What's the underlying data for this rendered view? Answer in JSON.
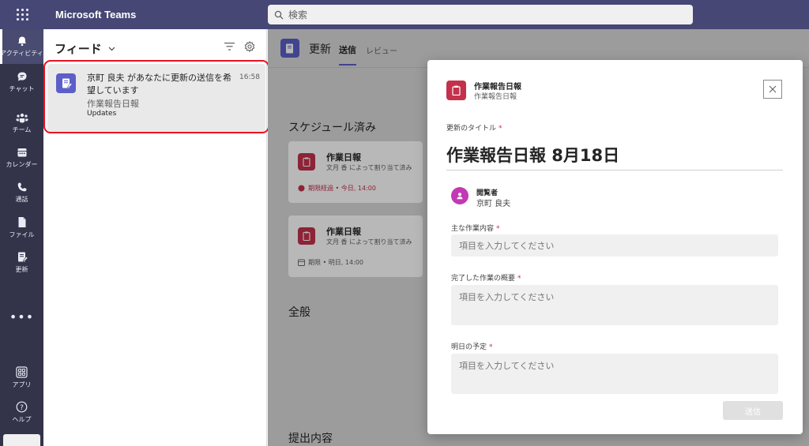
{
  "app": {
    "title": "Microsoft Teams"
  },
  "search": {
    "placeholder": "検索"
  },
  "rail": {
    "items": [
      {
        "label": "アクティビティ"
      },
      {
        "label": "チャット"
      },
      {
        "label": "チーム"
      },
      {
        "label": "カレンダー"
      },
      {
        "label": "通話"
      },
      {
        "label": "ファイル"
      },
      {
        "label": "更新"
      },
      {
        "label": "アプリ"
      },
      {
        "label": "ヘルプ"
      }
    ],
    "more": "•••"
  },
  "feed": {
    "title": "フィード",
    "item": {
      "message": "京町 良夫 があなたに更新の送信を希望しています",
      "subtitle": "作業報告日報",
      "app": "Updates",
      "time": "16:58"
    }
  },
  "main": {
    "title": "更新",
    "tabs": [
      {
        "label": "送信"
      },
      {
        "label": "レビュー"
      }
    ],
    "scheduled_title": "スケジュール済み",
    "cards": [
      {
        "title": "作業日報",
        "sub": "文月 香 によって割り当て済み",
        "due": "期限経過 • 今日, 14:00",
        "due_color": "#c4314b"
      },
      {
        "title": "作業日報",
        "sub": "文月 香 によって割り当て済み",
        "due": "期限 • 明日, 14:00",
        "due_color": "#616161"
      }
    ],
    "general_title": "全般",
    "submitted_title": "提出内容"
  },
  "modal": {
    "header_title": "作業報告日報",
    "header_sub": "作業報告日報",
    "title_label": "更新のタイトル",
    "title_value": "作業報告日報 8月18日",
    "viewer_label": "閲覧者",
    "viewer_name": "京町 良夫",
    "field1_label": "主な作業内容",
    "field1_placeholder": "項目を入力してください",
    "field2_label": "完了した作業の概要",
    "field2_placeholder": "項目を入力してください",
    "field3_label": "明日の予定",
    "field3_placeholder": "項目を入力してください",
    "required_mark": "*",
    "submit_label": "送信"
  },
  "colors": {
    "brand": "#464775",
    "rail": "#33344a",
    "accent": "#5b5fc7",
    "highlight": "#e81123"
  }
}
